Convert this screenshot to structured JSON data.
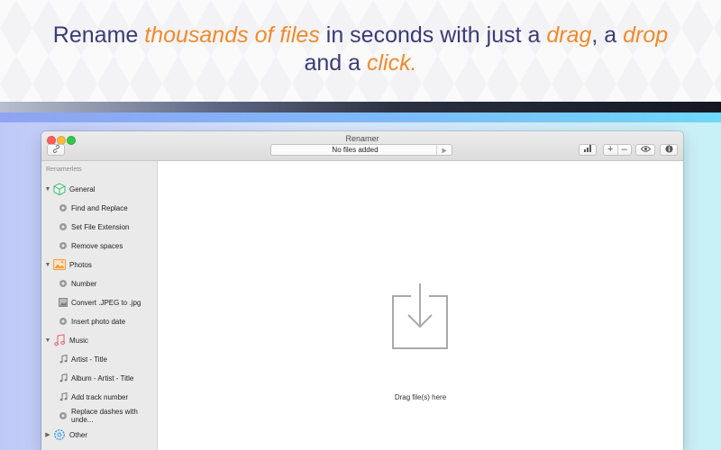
{
  "headline": {
    "parts": [
      {
        "text": "Rename ",
        "em": false
      },
      {
        "text": "thousands of files",
        "em": true
      },
      {
        "text": " in seconds with just a ",
        "em": false
      },
      {
        "text": "drag",
        "em": true
      },
      {
        "text": ", a ",
        "em": false
      },
      {
        "text": "drop",
        "em": true
      },
      {
        "text": " and a ",
        "em": false
      },
      {
        "text": "click.",
        "em": true
      }
    ]
  },
  "window": {
    "title": "Renamer",
    "status": "No files added",
    "toolbar": {
      "link_icon": "link-icon",
      "play_icon": "play-icon",
      "chart_icon": "bar-chart-icon",
      "plus_label": "+",
      "minus_label": "–",
      "eye_icon": "eye-icon",
      "info_icon": "info-icon"
    }
  },
  "sidebar": {
    "header": "Renamerlets",
    "groups": [
      {
        "label": "General",
        "icon": "cube-icon",
        "expanded": true,
        "items": [
          {
            "label": "Find and Replace",
            "icon": "gear-icon"
          },
          {
            "label": "Set File Extension",
            "icon": "gear-icon"
          },
          {
            "label": "Remove spaces",
            "icon": "gear-icon"
          }
        ]
      },
      {
        "label": "Photos",
        "icon": "photo-icon",
        "expanded": true,
        "items": [
          {
            "label": "Number",
            "icon": "gear-icon"
          },
          {
            "label": "Convert .JPEG to .jpg",
            "icon": "image-file-icon"
          },
          {
            "label": "Insert photo date",
            "icon": "photo-gear-icon"
          }
        ]
      },
      {
        "label": "Music",
        "icon": "music-note-icon",
        "expanded": true,
        "items": [
          {
            "label": "Artist - Title",
            "icon": "music-note-icon"
          },
          {
            "label": "Album - Artist - Title",
            "icon": "music-note-icon"
          },
          {
            "label": "Add track number",
            "icon": "music-note-icon"
          },
          {
            "label": "Replace dashes with unde...",
            "icon": "gear-icon"
          }
        ]
      },
      {
        "label": "Other",
        "icon": "gear-icon",
        "expanded": false,
        "items": []
      }
    ]
  },
  "main": {
    "drop_icon": "download-tray-icon",
    "drop_label": "Drag file(s) here"
  },
  "colors": {
    "headline": "#3a3b77",
    "accent": "#f08a2c"
  }
}
